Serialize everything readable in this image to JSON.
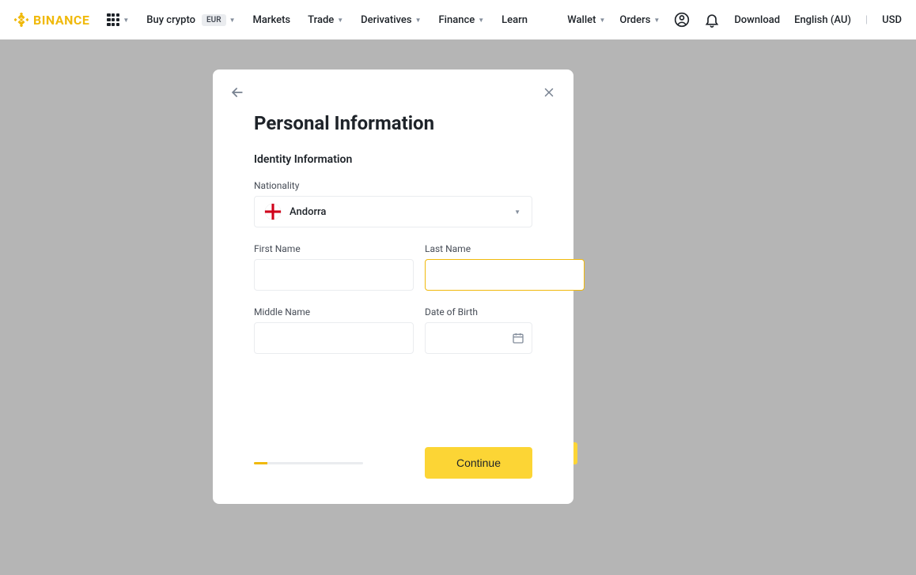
{
  "brand": "BINANCE",
  "nav": {
    "buy_crypto": "Buy crypto",
    "currency_pill": "EUR",
    "markets": "Markets",
    "trade": "Trade",
    "derivatives": "Derivatives",
    "finance": "Finance",
    "learn": "Learn"
  },
  "nav_right": {
    "wallet": "Wallet",
    "orders": "Orders",
    "download": "Download",
    "language": "English (AU)",
    "fiat": "USD"
  },
  "modal": {
    "title": "Personal Information",
    "section": "Identity Information",
    "labels": {
      "nationality": "Nationality",
      "first_name": "First Name",
      "last_name": "Last Name",
      "middle_name": "Middle Name",
      "dob": "Date of Birth"
    },
    "nationality_value": "Andorra",
    "continue": "Continue"
  }
}
